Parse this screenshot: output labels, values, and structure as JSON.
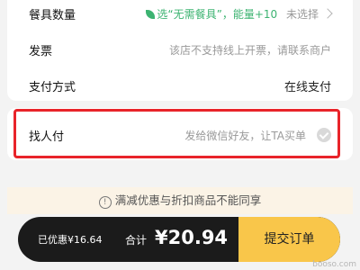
{
  "order": {
    "tableware": {
      "label": "餐具数量",
      "promo": "选“无需餐具”，能量+10",
      "value": "未选择"
    },
    "invoice": {
      "label": "发票",
      "value": "该店不支持线上开票，请联系商户"
    },
    "payment_method": {
      "label": "支付方式",
      "value": "在线支付"
    },
    "find_payer": {
      "label": "找人付",
      "hint": "发给微信好友，让TA买单"
    }
  },
  "notice": {
    "icon": "!",
    "text": "满减优惠与折扣商品不能同享"
  },
  "checkout": {
    "saved": "已优惠¥16.64",
    "total_label": "合计",
    "total": "¥20.94",
    "submit": "提交订单"
  },
  "watermark": "booso.com",
  "colors": {
    "accent": "#f9c64a",
    "highlight": "#e8242a",
    "promo": "#3cb371",
    "bar": "#1b1b1b"
  }
}
